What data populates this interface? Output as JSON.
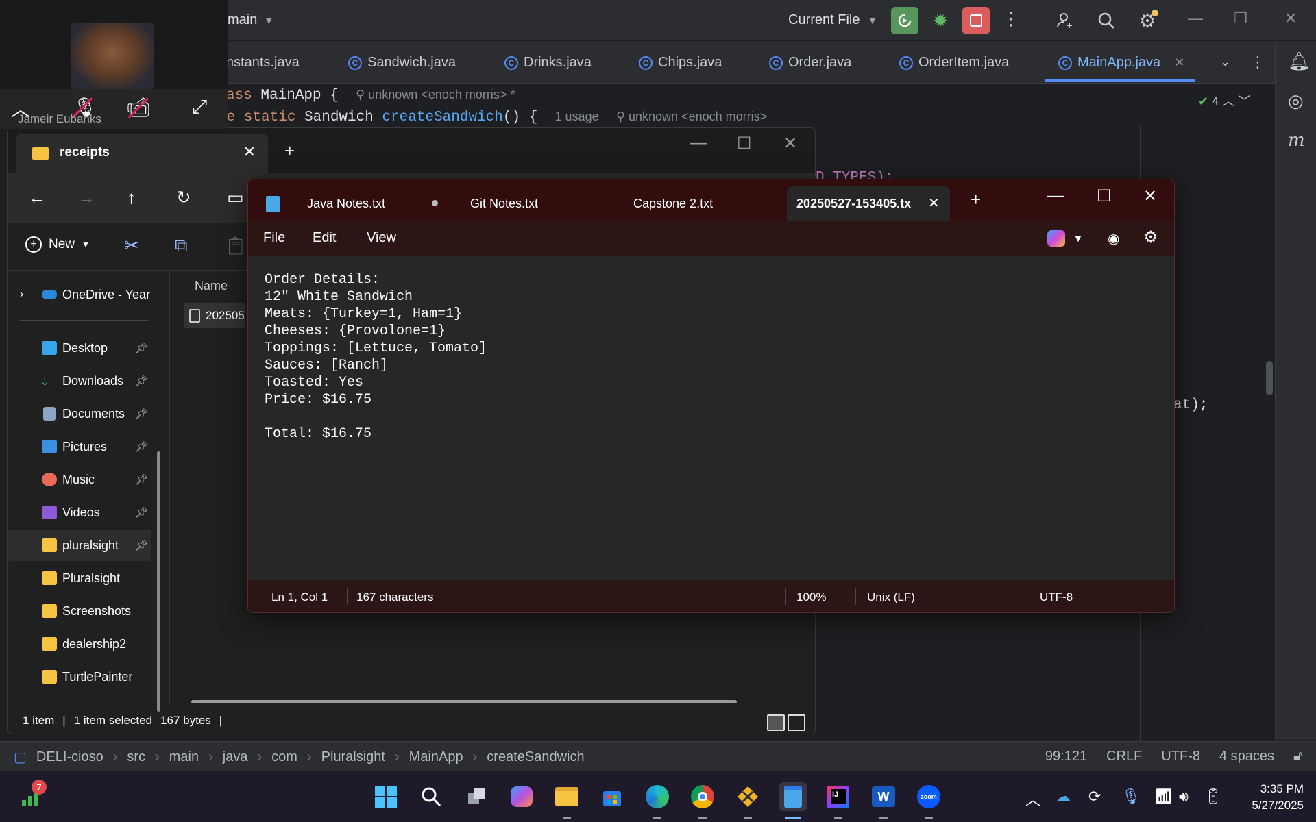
{
  "zoom": {
    "participant_name": "Jameir Eubanks"
  },
  "ide": {
    "branch": "main",
    "run_config": "Current File",
    "inspections_count": "4",
    "tabs": [
      {
        "label": "nstants.java"
      },
      {
        "label": "Sandwich.java"
      },
      {
        "label": "Drinks.java"
      },
      {
        "label": "Chips.java"
      },
      {
        "label": "Order.java"
      },
      {
        "label": "OrderItem.java"
      },
      {
        "label": "MainApp.java"
      }
    ],
    "code": {
      "line1_kw": "ass",
      "line1_name": " MainApp {",
      "line1_hint": "unknown <enoch morris> *",
      "line2_kw": "te static",
      "line2_type": " Sandwich ",
      "line2_fn": "createSandwich",
      "line2_rest": "() {",
      "line2_usage": "1 usage",
      "line2_hint": "unknown <enoch morris>",
      "frag_top": "D_TYPES);",
      "frag_right": "at);"
    },
    "breadcrumbs": [
      "DELI-cioso",
      "src",
      "main",
      "java",
      "com",
      "Pluralsight",
      "MainApp",
      "createSandwich"
    ],
    "status": {
      "position": "99:121",
      "line_sep": "CRLF",
      "encoding": "UTF-8",
      "indent": "4 spaces"
    }
  },
  "explorer": {
    "tab_title": "receipts",
    "new_label": "New",
    "column_name": "Name",
    "file_name": "202505",
    "sidebar": [
      {
        "label": "OneDrive - Year",
        "pinned": false
      },
      {
        "label": "Desktop",
        "pinned": true
      },
      {
        "label": "Downloads",
        "pinned": true
      },
      {
        "label": "Documents",
        "pinned": true
      },
      {
        "label": "Pictures",
        "pinned": true
      },
      {
        "label": "Music",
        "pinned": true
      },
      {
        "label": "Videos",
        "pinned": true
      },
      {
        "label": "pluralsight",
        "pinned": true
      },
      {
        "label": "Pluralsight",
        "pinned": false
      },
      {
        "label": "Screenshots",
        "pinned": false
      },
      {
        "label": "dealership2",
        "pinned": false
      },
      {
        "label": "TurtlePainter",
        "pinned": false
      }
    ],
    "status": {
      "items": "1 item",
      "selected": "1 item selected",
      "size": "167 bytes"
    }
  },
  "notepad": {
    "tabs": [
      {
        "label": "Java Notes.txt",
        "unsaved": true
      },
      {
        "label": "Git Notes.txt",
        "unsaved": false
      },
      {
        "label": "Capstone 2.txt",
        "unsaved": false
      },
      {
        "label": "20250527-153405.tx",
        "unsaved": false
      }
    ],
    "menu": {
      "file": "File",
      "edit": "Edit",
      "view": "View"
    },
    "content": [
      "Order Details:",
      "12\" White Sandwich",
      "Meats: {Turkey=1, Ham=1}",
      "Cheeses: {Provolone=1}",
      "Toppings: [Lettuce, Tomato]",
      "Sauces: [Ranch]",
      "Toasted: Yes",
      "Price: $16.75",
      "",
      "Total: $16.75"
    ],
    "status": {
      "position": "Ln 1, Col 1",
      "characters": "167 characters",
      "zoom": "100%",
      "line_ending": "Unix (LF)",
      "encoding": "UTF-8"
    }
  },
  "taskbar": {
    "widget_badge": "7",
    "time": "3:35 PM",
    "date": "5/27/2025"
  },
  "colors": {
    "ide_bg": "#1e1f22",
    "ide_accent": "#548af7",
    "run_green": "#57965c",
    "stop_red": "#db5c5c",
    "notepad_titlebar": "#330d0d",
    "explorer_bg": "#202020"
  }
}
